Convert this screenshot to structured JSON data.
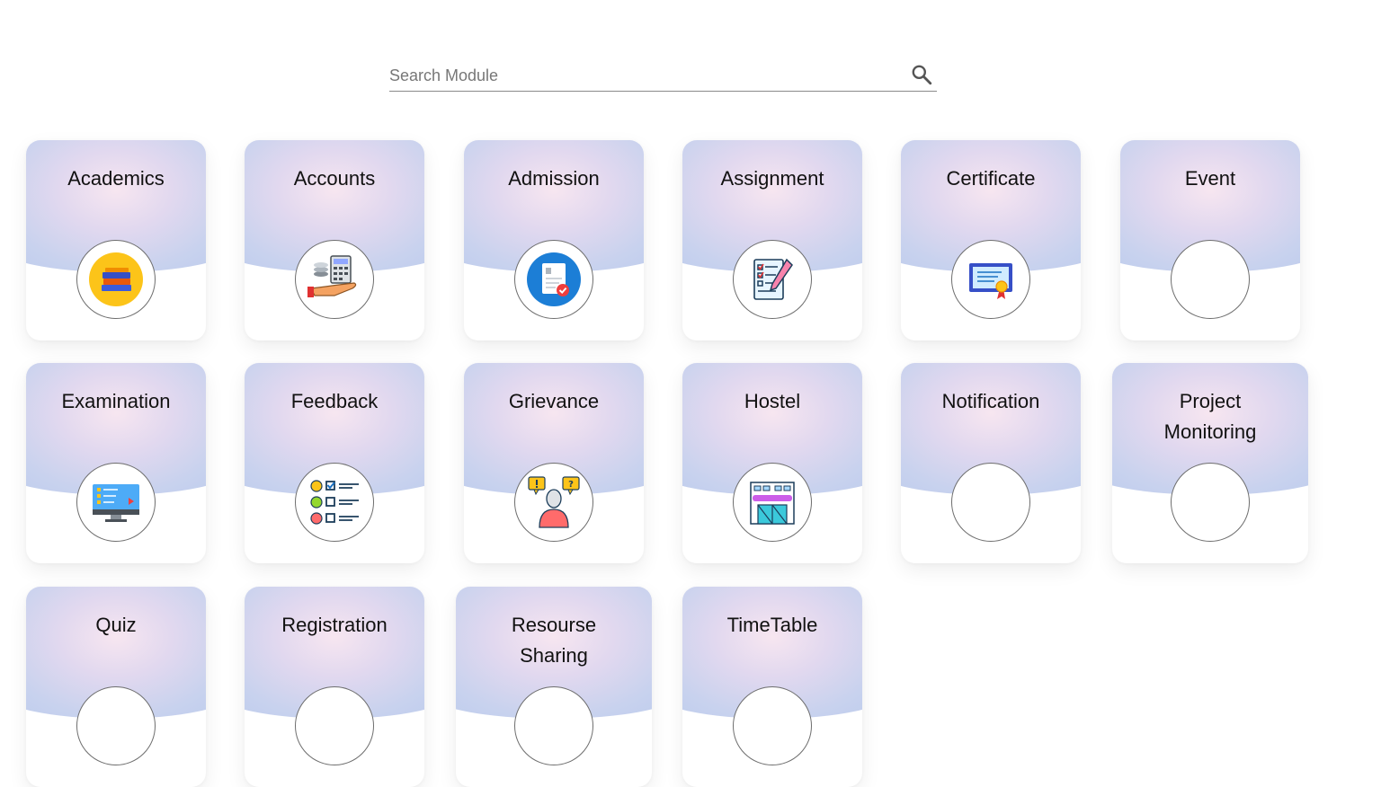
{
  "search": {
    "placeholder": "Search Module",
    "icon": "search-icon"
  },
  "modules": [
    {
      "label": "Academics",
      "icon": "books-icon"
    },
    {
      "label": "Accounts",
      "icon": "calculator-hand-icon"
    },
    {
      "label": "Admission",
      "icon": "document-check-icon"
    },
    {
      "label": "Assignment",
      "icon": "checklist-pen-icon"
    },
    {
      "label": "Certificate",
      "icon": "certificate-icon"
    },
    {
      "label": "Event",
      "icon": ""
    },
    {
      "label": "Examination",
      "icon": "monitor-quiz-icon"
    },
    {
      "label": "Feedback",
      "icon": "feedback-faces-icon"
    },
    {
      "label": "Grievance",
      "icon": "person-question-icon"
    },
    {
      "label": "Hostel",
      "icon": "hostel-building-icon"
    },
    {
      "label": "Notification",
      "icon": ""
    },
    {
      "label": "Project Monitoring",
      "icon": ""
    },
    {
      "label": "Quiz",
      "icon": ""
    },
    {
      "label": "Registration",
      "icon": ""
    },
    {
      "label": "Resourse Sharing",
      "icon": ""
    },
    {
      "label": "TimeTable",
      "icon": ""
    }
  ]
}
